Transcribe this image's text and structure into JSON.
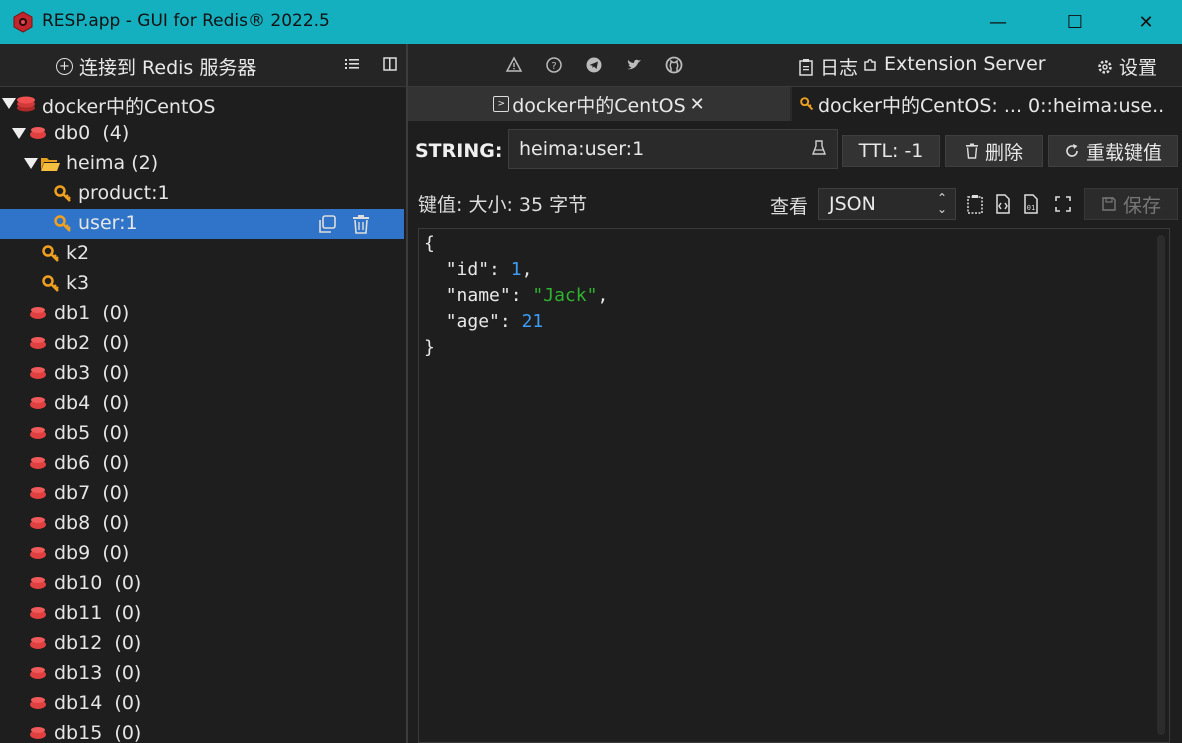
{
  "window": {
    "title": "RESP.app - GUI for Redis® 2022.5",
    "minimize_glyph": "—",
    "maximize_glyph": "☐",
    "close_glyph": "✕"
  },
  "toolbar": {
    "connect_label": "连接到 Redis 服务器",
    "log_label": "日志",
    "extension_label": "Extension Server",
    "settings_label": "设置",
    "icons": [
      "warning-icon",
      "help-icon",
      "telegram-icon",
      "twitter-icon",
      "github-icon"
    ]
  },
  "tree": {
    "connection": "docker中的CentOS",
    "db0": {
      "name": "db0",
      "count": "(4)"
    },
    "folder": {
      "name": "heima",
      "count": "(2)"
    },
    "keys": [
      "product:1",
      "user:1",
      "k2",
      "k3"
    ],
    "dbs": [
      {
        "name": "db1",
        "count": "(0)"
      },
      {
        "name": "db2",
        "count": "(0)"
      },
      {
        "name": "db3",
        "count": "(0)"
      },
      {
        "name": "db4",
        "count": "(0)"
      },
      {
        "name": "db5",
        "count": "(0)"
      },
      {
        "name": "db6",
        "count": "(0)"
      },
      {
        "name": "db7",
        "count": "(0)"
      },
      {
        "name": "db8",
        "count": "(0)"
      },
      {
        "name": "db9",
        "count": "(0)"
      },
      {
        "name": "db10",
        "count": "(0)"
      },
      {
        "name": "db11",
        "count": "(0)"
      },
      {
        "name": "db12",
        "count": "(0)"
      },
      {
        "name": "db13",
        "count": "(0)"
      },
      {
        "name": "db14",
        "count": "(0)"
      },
      {
        "name": "db15",
        "count": "(0)"
      }
    ]
  },
  "tabs": [
    {
      "label": "docker中的CentOS"
    },
    {
      "label": "docker中的CentOS: ... 0::heima:use.."
    }
  ],
  "key_view": {
    "type_label": "STRING:",
    "key_name": "heima:user:1",
    "ttl_label": "TTL:",
    "ttl_value": "-1",
    "delete_label": "删除",
    "reload_label": "重载键值",
    "value_meta": "键值: 大小: 35 字节",
    "view_label": "查看",
    "format": "JSON",
    "save_label": "保存"
  },
  "json_value": {
    "open": "{",
    "id_key": "\"id\"",
    "id_val": "1",
    "name_key": "\"name\"",
    "name_val": "\"Jack\"",
    "age_key": "\"age\"",
    "age_val": "21",
    "close": "}"
  },
  "colors": {
    "titlebar": "#15b0bf",
    "selection": "#2f74c8",
    "redis_red": "#e04040",
    "key_gold": "#f0a020",
    "json_number": "#3d9df6",
    "json_string": "#2fb32f"
  }
}
